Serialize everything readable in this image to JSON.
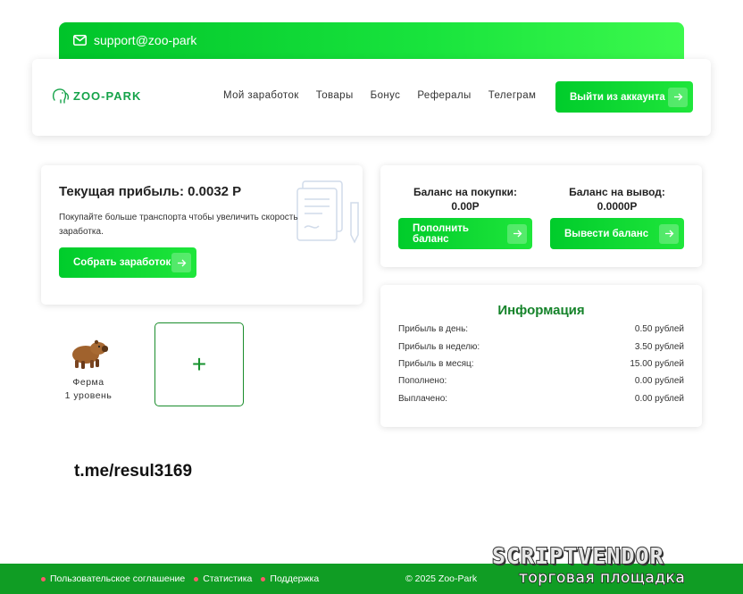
{
  "topbar": {
    "email": "support@zoo-park",
    "icon": "envelope-icon"
  },
  "header": {
    "logo": "ZOO-PARK",
    "nav": [
      "Мой заработок",
      "Товары",
      "Бонус",
      "Рефералы",
      "Телеграм"
    ],
    "logout_label": "Выйти из аккаунта"
  },
  "profit": {
    "title": "Текущая прибыль: 0.0032 Р",
    "description": "Покупайте больше транспорта чтобы увеличить скорость заработка.",
    "collect_label": "Собрать заработок"
  },
  "balance": {
    "purchase_label": "Баланс на покупки:",
    "purchase_value": "0.00Р",
    "withdraw_label": "Баланс на вывод:",
    "withdraw_value": "0.0000Р",
    "topup_button": "Пополнить баланс",
    "withdraw_button": "Вывести баланс"
  },
  "info": {
    "title": "Информация",
    "rows": [
      {
        "label": "Прибыль в день:",
        "value": "0.50 рублей"
      },
      {
        "label": "Прибыль в неделю:",
        "value": "3.50 рублей"
      },
      {
        "label": "Прибыль в месяц:",
        "value": "15.00 рублей"
      },
      {
        "label": "Пополнено:",
        "value": "0.00 рублей"
      },
      {
        "label": "Выплачено:",
        "value": "0.00 рублей"
      }
    ]
  },
  "farm": {
    "name": "Ферма",
    "level": "1 уровень",
    "icon": "capybara-icon",
    "add_symbol": "+"
  },
  "telegram_link": "t.me/resul3169",
  "footer": {
    "links": [
      "Пользовательское соглашение",
      "Статистика",
      "Поддержка"
    ],
    "copyright": "© 2025 Zoo-Park"
  },
  "watermark": {
    "title": "SCRIPTVENDOR",
    "subtitle": "торговая площадка"
  },
  "colors": {
    "accent": "#00cc2b",
    "info_title": "#15832a",
    "footer": "#109d24",
    "footer_dot": "#ff5a6a"
  }
}
